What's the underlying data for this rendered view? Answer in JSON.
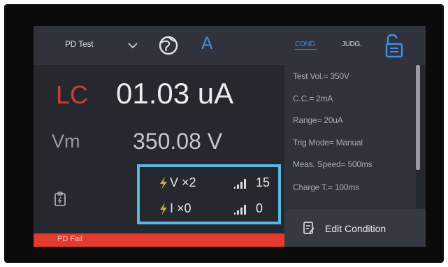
{
  "topbar": {
    "mode_title": "PD Test",
    "chevron_icon": "chevron-down-icon",
    "globe_icon": "globe-icon",
    "font_indicator": "A",
    "tabs": [
      {
        "label": "COND.",
        "active": true
      },
      {
        "label": "JUDG.",
        "active": false
      }
    ],
    "lock_icon": "lock-open-icon"
  },
  "readings": {
    "lc_label": "LC",
    "lc_value": "01.03 uA",
    "vm_label": "Vm",
    "vm_value": "350.08 V"
  },
  "stats": {
    "v_count": "V ×2",
    "v_signal": "15",
    "i_count": "I ×0",
    "i_signal": "0"
  },
  "conditions": [
    "Test Vol.= 350V",
    "C.C.= 2mA",
    "Range= 20uA",
    "Trig Mode= Manual",
    "Meas. Speed= 500ms",
    "Charge T.= 100ms"
  ],
  "edit_button": {
    "label": "Edit Condition",
    "icon": "edit-document-icon"
  },
  "status": {
    "text": "PD Fail"
  },
  "colors": {
    "accent": "#3f8fe8",
    "fail": "#e23b2e",
    "highlight": "#5ab6e0",
    "lc_label": "#d93a35",
    "bolt": "#c9b13a"
  }
}
